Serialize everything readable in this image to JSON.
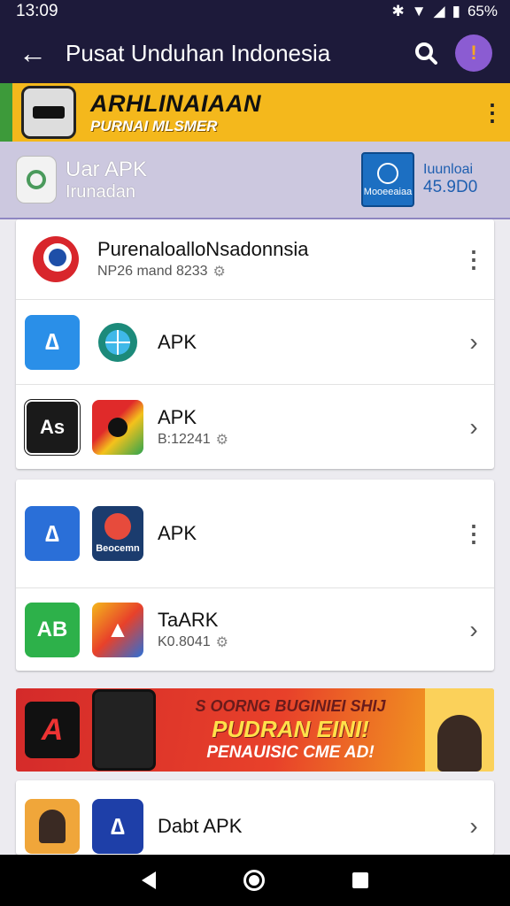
{
  "status_bar": {
    "time": "13:09",
    "battery": "65%"
  },
  "app_bar": {
    "title": "Pusat Unduhan Indonesia"
  },
  "promo": {
    "title": "ARHLINAIAAN",
    "subtitle": "PURNAI MLSMER"
  },
  "account": {
    "title": "Uar APK",
    "subtitle": "Irunadan",
    "badge_label": "Mooeeaiaa",
    "amount_label": "Iuunloai",
    "amount_value": "45.9D0"
  },
  "cards": [
    {
      "rows": [
        {
          "title": "PurenaloalloNsadonnsia",
          "subtitle": "NP26 mand 8233",
          "action": "⋮"
        },
        {
          "title": "APK",
          "subtitle": "",
          "action": "›"
        },
        {
          "title": "APK",
          "subtitle": "B:12241",
          "action": "›"
        }
      ]
    },
    {
      "rows": [
        {
          "title": "APK",
          "subtitle": "",
          "action": "⋮",
          "icon2_label": "Beocemn"
        },
        {
          "title": "TaARK",
          "subtitle": "K0.8041",
          "action": "›"
        }
      ]
    },
    {
      "rows": [
        {
          "title": "Dabt APK",
          "subtitle": "",
          "action": "›"
        }
      ]
    }
  ],
  "ad": {
    "line1": "S OORNG BUGINIEI SHIJ",
    "line2": "PUDRAN EINI!",
    "line3": "PENAUISIC CME AD!"
  }
}
